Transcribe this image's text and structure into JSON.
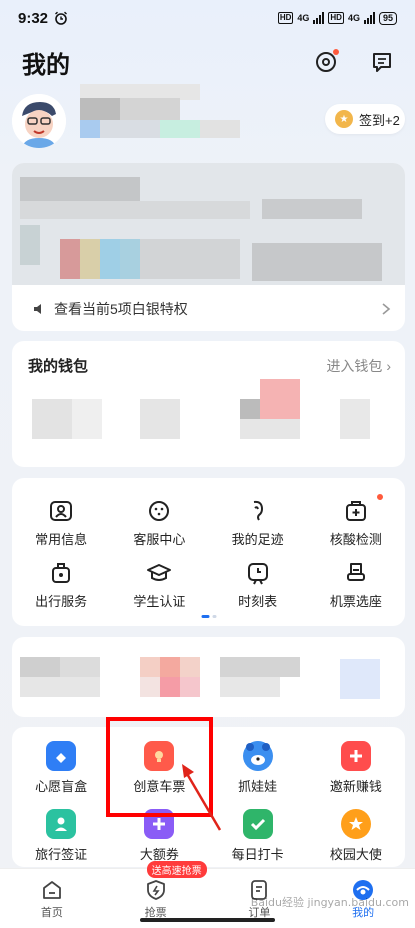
{
  "status": {
    "time": "9:32",
    "battery": "95",
    "network": "4G"
  },
  "header": {
    "title": "我的"
  },
  "profile": {
    "checkin_label": "签到+2"
  },
  "member": {
    "privilege_text": "查看当前5项白银特权"
  },
  "wallet": {
    "title": "我的钱包",
    "link": "进入钱包"
  },
  "services": {
    "row1": [
      {
        "label": "常用信息",
        "icon": "contact-card-icon"
      },
      {
        "label": "客服中心",
        "icon": "customer-service-icon"
      },
      {
        "label": "我的足迹",
        "icon": "footprint-icon"
      },
      {
        "label": "核酸检测",
        "icon": "medical-test-icon"
      }
    ],
    "row2": [
      {
        "label": "出行服务",
        "icon": "travel-bag-icon"
      },
      {
        "label": "学生认证",
        "icon": "graduation-cap-icon"
      },
      {
        "label": "时刻表",
        "icon": "timetable-icon"
      },
      {
        "label": "机票选座",
        "icon": "seat-icon"
      }
    ]
  },
  "activities": {
    "row1": [
      {
        "label": "心愿盲盒",
        "color": "#2f7ef5"
      },
      {
        "label": "创意车票",
        "color": "#ff5a4a"
      },
      {
        "label": "抓娃娃",
        "color": "#3b8ff0"
      },
      {
        "label": "邀新赚钱",
        "color": "#ff4d4d"
      }
    ],
    "row2": [
      {
        "label": "旅行签证",
        "color": "#2bc2a0"
      },
      {
        "label": "大额券",
        "color": "#8a5cf6"
      },
      {
        "label": "每日打卡",
        "color": "#2fb56a"
      },
      {
        "label": "校园大使",
        "color": "#ff9f1a"
      }
    ]
  },
  "tabbar": {
    "items": [
      {
        "label": "首页"
      },
      {
        "label": "抢票",
        "badge": "送高速抢票"
      },
      {
        "label": "订单"
      },
      {
        "label": "我的"
      }
    ]
  },
  "watermark": "Baidu经验 jingyan.baidu.com",
  "colors": {
    "accent": "#1e6ff0",
    "highlight": "#ff0000"
  }
}
